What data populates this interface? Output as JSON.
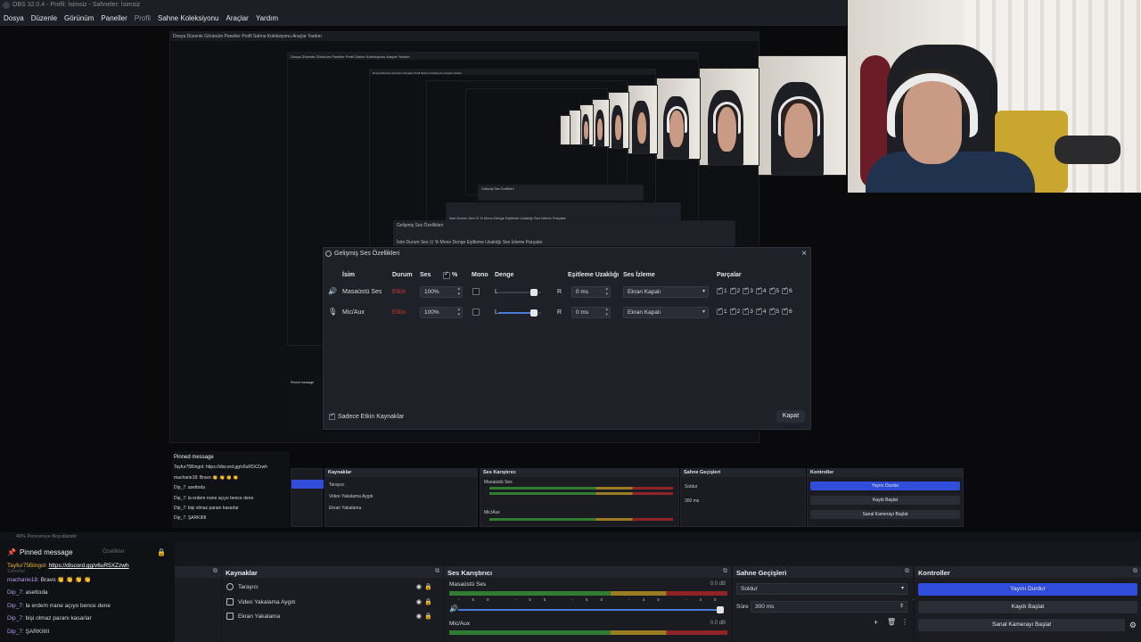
{
  "window": {
    "title": "OBS 32.0.4 - Profil: İsimsiz - Sahneler: İsimsiz"
  },
  "menu": [
    "Dosya",
    "Düzenle",
    "Görünüm",
    "Paneller",
    "Profil",
    "Sahne Koleksiyonu",
    "Araçlar",
    "Yardım"
  ],
  "mini_menu": "Dosya  Düzenle  Görünüm  Paneller  Profil  Sahne Koleksiyonu  Araçlar  Yardım",
  "dialog": {
    "title": "Gelişmiş Ses Özellikleri",
    "close": "×",
    "headers": {
      "name": "İsim",
      "status": "Durum",
      "volume": "Ses",
      "percent": "%",
      "mono": "Mono",
      "balance": "Denge",
      "sync_offset": "Eşitleme Uzaklığı",
      "monitoring": "Ses İzleme",
      "tracks": "Parçalar"
    },
    "rows": [
      {
        "name": "Masaüstü Ses",
        "status": "Etkin",
        "volume": "100%",
        "balance_left": "L",
        "balance_right": "R",
        "sync": "0 ms",
        "monitor": "Ekran Kapalı",
        "tracks": [
          "1",
          "2",
          "3",
          "4",
          "5",
          "6"
        ]
      },
      {
        "name": "Mic/Aux",
        "status": "Etkin",
        "volume": "100%",
        "balance_left": "L",
        "balance_right": "R",
        "sync": "0 ms",
        "monitor": "Ekran Kapalı",
        "tracks": [
          "1",
          "2",
          "3",
          "4",
          "5",
          "6"
        ]
      }
    ],
    "only_active": "Sadece Etkin Kaynaklar",
    "close_button": "Kapat"
  },
  "status_strip": "49%    Pencereye Boyutlandır",
  "chat": {
    "pinned": "Pinned message",
    "pinned_icons": "Özellikler",
    "pinned_user": "Tayfur75Bingol:",
    "pinned_link": "https://discord.gg/v6uR5XZzwh",
    "side_label": "Sahneler",
    "messages": [
      {
        "user": "macharie18:",
        "text": "Bravo 👏 👏 👏 👏"
      },
      {
        "user": "Dip_7:",
        "text": "asettoda"
      },
      {
        "user": "Dip_7:",
        "text": "la erdem rrane açıyo bence dene"
      },
      {
        "user": "Dip_7:",
        "text": "bişi olmaz paranı kasarlar"
      },
      {
        "user": "Dip_7:",
        "text": "ŞARKIIIII"
      }
    ]
  },
  "docks": {
    "sources": {
      "title": "Kaynaklar",
      "items": [
        "Tarayıcı",
        "Video Yakalama Aygıtı",
        "Ekran Yakalama"
      ]
    },
    "mixer": {
      "title": "Ses Karıştırıcı",
      "channels": [
        {
          "name": "Masaüstü Ses",
          "db": "0.0 dB"
        },
        {
          "name": "Mic/Aux",
          "db": "0.0 dB"
        }
      ],
      "ticks": "-60 -55 -50 -45 -40 -35 -30 -25 -20 -15 -10 -5 0"
    },
    "transitions": {
      "title": "Sahne Geçişleri",
      "type": "Soldur",
      "duration_label": "Süre",
      "duration": "300 ms"
    },
    "controls": {
      "title": "Kontroller",
      "buttons": [
        "Yayını Durdur",
        "Kaydı Başlat",
        "Sanal Kamerayı Başlat"
      ]
    }
  },
  "mini_dialogs": [
    {
      "title": "Gelişmiş Ses Özellikleri",
      "cols": "İsim   Durum  Ses  ☑ %   Mono  Denge   Eşitleme Uzaklığı  Ses İzleme   Parçalar"
    }
  ],
  "colors": {
    "accent": "#2f4dd8",
    "status_red": "#c0392b",
    "bg": "#0c0c0e"
  }
}
